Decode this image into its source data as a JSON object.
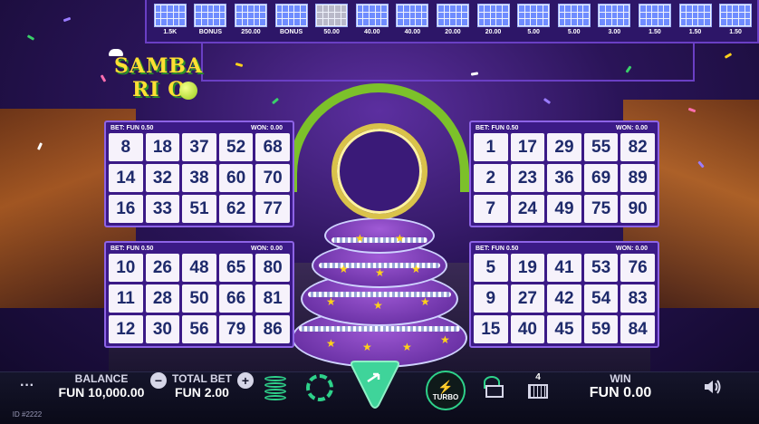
{
  "paytable": [
    {
      "label": "1.5K",
      "highlight": false
    },
    {
      "label": "BONUS",
      "highlight": false
    },
    {
      "label": "250.00",
      "highlight": false
    },
    {
      "label": "BONUS",
      "highlight": false
    },
    {
      "label": "50.00",
      "highlight": true
    },
    {
      "label": "40.00",
      "highlight": false
    },
    {
      "label": "40.00",
      "highlight": false
    },
    {
      "label": "20.00",
      "highlight": false
    },
    {
      "label": "20.00",
      "highlight": false
    },
    {
      "label": "5.00",
      "highlight": false
    },
    {
      "label": "5.00",
      "highlight": false
    },
    {
      "label": "3.00",
      "highlight": false
    },
    {
      "label": "1.50",
      "highlight": false
    },
    {
      "label": "1.50",
      "highlight": false
    },
    {
      "label": "1.50",
      "highlight": false
    }
  ],
  "logo": {
    "line1": "SAMBA",
    "line2": "RI O"
  },
  "cards": [
    {
      "bet": "BET: FUN 0.50",
      "won": "WON: 0.00",
      "numbers": [
        "8",
        "18",
        "37",
        "52",
        "68",
        "14",
        "32",
        "38",
        "60",
        "70",
        "16",
        "33",
        "51",
        "62",
        "77"
      ]
    },
    {
      "bet": "BET: FUN 0.50",
      "won": "WON: 0.00",
      "numbers": [
        "1",
        "17",
        "29",
        "55",
        "82",
        "2",
        "23",
        "36",
        "69",
        "89",
        "7",
        "24",
        "49",
        "75",
        "90"
      ]
    },
    {
      "bet": "BET: FUN 0.50",
      "won": "WON: 0.00",
      "numbers": [
        "10",
        "26",
        "48",
        "65",
        "80",
        "11",
        "28",
        "50",
        "66",
        "81",
        "12",
        "30",
        "56",
        "79",
        "86"
      ]
    },
    {
      "bet": "BET: FUN 0.50",
      "won": "WON: 0.00",
      "numbers": [
        "5",
        "19",
        "41",
        "53",
        "76",
        "9",
        "27",
        "42",
        "54",
        "83",
        "15",
        "40",
        "45",
        "59",
        "84"
      ]
    }
  ],
  "bottom": {
    "menu": "···",
    "balance_label": "BALANCE",
    "balance_value": "FUN 10,000.00",
    "minus": "−",
    "total_bet_label": "TOTAL BET",
    "total_bet_value": "FUN 2.00",
    "plus": "+",
    "turbo": "TURBO",
    "cards_count": "4",
    "win_label": "WIN",
    "win_value": "FUN 0.00",
    "id": "ID #2222"
  },
  "colors": {
    "accent": "#2ed18a",
    "card_bg": "#3b1a86",
    "number": "#1e2a6b"
  }
}
